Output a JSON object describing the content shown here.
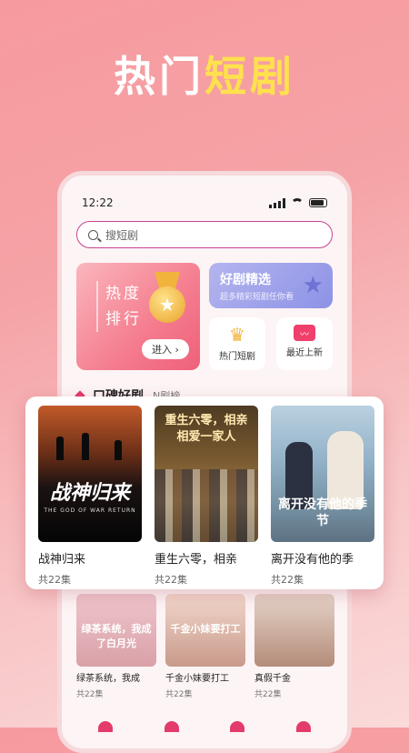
{
  "promo": {
    "headline_white": "热门",
    "headline_yellow": "短剧"
  },
  "status": {
    "time": "12:22"
  },
  "search": {
    "placeholder": "搜短剧"
  },
  "hot_card": {
    "line1": "热度",
    "line2": "排行",
    "enter_label": "进入"
  },
  "pick_card": {
    "title": "好剧精选",
    "subtitle": "超多精彩短剧任你看"
  },
  "quick_links": [
    {
      "label": "热门短剧",
      "icon": "crown-icon"
    },
    {
      "label": "最近上新",
      "icon": "tv-icon"
    }
  ],
  "tabs": {
    "active": "口碑好剧",
    "inactive": "N剧榜"
  },
  "featured": [
    {
      "cover_title": "战神归来",
      "cover_sub": "THE GOD OF WAR RETURN",
      "name": "战神归来",
      "episodes": "共22集"
    },
    {
      "cover_title": "重生六零，相亲相爱一家人",
      "name": "重生六零，相亲",
      "episodes": "共22集"
    },
    {
      "cover_title": "离开没有他的季节",
      "name": "离开没有他的季",
      "episodes": "共22集"
    }
  ],
  "more": [
    {
      "cover_title": "绿茶系统，我成了白月光",
      "name": "绿茶系统，我成",
      "episodes": "共22集"
    },
    {
      "cover_title": "千金小妹要打工",
      "name": "千金小妹要打工",
      "episodes": "共22集"
    },
    {
      "name": "真假千金",
      "episodes": "共22集"
    }
  ],
  "colors": {
    "accent": "#e33b6b",
    "search_border": "#c8448f",
    "headline_yellow": "#ffe14d"
  }
}
